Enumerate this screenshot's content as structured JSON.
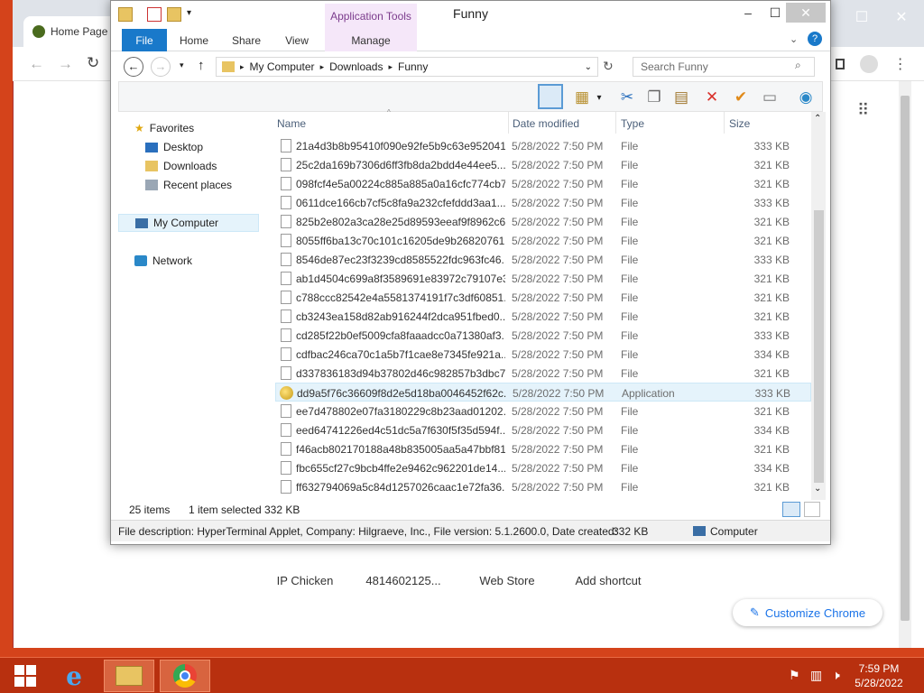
{
  "chrome": {
    "tab_label": "Home Page",
    "shortcuts": [
      "IP Chicken",
      "4814602125...",
      "Web Store",
      "Add shortcut"
    ],
    "customize_label": "Customize Chrome"
  },
  "explorer": {
    "title": "Funny",
    "context_tab": "Application Tools",
    "tabs": [
      "File",
      "Home",
      "Share",
      "View",
      "Manage"
    ],
    "breadcrumb": [
      "My Computer",
      "Downloads",
      "Funny"
    ],
    "search_placeholder": "Search Funny",
    "nav": {
      "favorites": "Favorites",
      "desktop": "Desktop",
      "downloads": "Downloads",
      "recent": "Recent places",
      "my_computer": "My Computer",
      "network": "Network"
    },
    "columns": {
      "name": "Name",
      "date": "Date modified",
      "type": "Type",
      "size": "Size"
    },
    "files": [
      {
        "name": "21a4d3b8b95410f090e92fe5b9c63e952041...",
        "date": "5/28/2022 7:50 PM",
        "type": "File",
        "size": "333 KB"
      },
      {
        "name": "25c2da169b7306d6ff3fb8da2bdd4e44ee5...",
        "date": "5/28/2022 7:50 PM",
        "type": "File",
        "size": "321 KB"
      },
      {
        "name": "098fcf4e5a00224c885a885a0a16cfc774cb7...",
        "date": "5/28/2022 7:50 PM",
        "type": "File",
        "size": "321 KB"
      },
      {
        "name": "0611dce166cb7cf5c8fa9a232cfefddd3aa1...",
        "date": "5/28/2022 7:50 PM",
        "type": "File",
        "size": "333 KB"
      },
      {
        "name": "825b2e802a3ca28e25d89593eeaf9f8962c6...",
        "date": "5/28/2022 7:50 PM",
        "type": "File",
        "size": "321 KB"
      },
      {
        "name": "8055ff6ba13c70c101c16205de9b26820761...",
        "date": "5/28/2022 7:50 PM",
        "type": "File",
        "size": "321 KB"
      },
      {
        "name": "8546de87ec23f3239cd8585522fdc963fc46...",
        "date": "5/28/2022 7:50 PM",
        "type": "File",
        "size": "333 KB"
      },
      {
        "name": "ab1d4504c699a8f3589691e83972c79107e3...",
        "date": "5/28/2022 7:50 PM",
        "type": "File",
        "size": "321 KB"
      },
      {
        "name": "c788ccc82542e4a5581374191f7c3df60851...",
        "date": "5/28/2022 7:50 PM",
        "type": "File",
        "size": "321 KB"
      },
      {
        "name": "cb3243ea158d82ab916244f2dca951fbed0...",
        "date": "5/28/2022 7:50 PM",
        "type": "File",
        "size": "321 KB"
      },
      {
        "name": "cd285f22b0ef5009cfa8faaadcc0a71380af3...",
        "date": "5/28/2022 7:50 PM",
        "type": "File",
        "size": "333 KB"
      },
      {
        "name": "cdfbac246ca70c1a5b7f1cae8e7345fe921a...",
        "date": "5/28/2022 7:50 PM",
        "type": "File",
        "size": "334 KB"
      },
      {
        "name": "d337836183d94b37802d46c982857b3dbc7...",
        "date": "5/28/2022 7:50 PM",
        "type": "File",
        "size": "321 KB"
      },
      {
        "name": "dd9a5f76c36609f8d2e5d18ba0046452f62c...",
        "date": "5/28/2022 7:50 PM",
        "type": "Application",
        "size": "333 KB",
        "selected": true
      },
      {
        "name": "ee7d478802e07fa3180229c8b23aad01202...",
        "date": "5/28/2022 7:50 PM",
        "type": "File",
        "size": "321 KB"
      },
      {
        "name": "eed64741226ed4c51dc5a7f630f5f35d594f...",
        "date": "5/28/2022 7:50 PM",
        "type": "File",
        "size": "334 KB"
      },
      {
        "name": "f46acb802170188a48b835005aa5a47bbf81...",
        "date": "5/28/2022 7:50 PM",
        "type": "File",
        "size": "321 KB"
      },
      {
        "name": "fbc655cf27c9bcb4ffe2e9462c962201de14...",
        "date": "5/28/2022 7:50 PM",
        "type": "File",
        "size": "334 KB"
      },
      {
        "name": "ff632794069a5c84d1257026caac1e72fa36...",
        "date": "5/28/2022 7:50 PM",
        "type": "File",
        "size": "321 KB"
      }
    ],
    "status": {
      "count": "25 items",
      "selected": "1 item selected",
      "size": "332 KB"
    },
    "details": {
      "description": "File description: HyperTerminal Applet, Company: Hilgraeve, Inc., File version: 5.1.2600.0, Date created:",
      "size": "332 KB",
      "location": "Computer"
    }
  },
  "taskbar": {
    "time": "7:59 PM",
    "date": "5/28/2022"
  }
}
